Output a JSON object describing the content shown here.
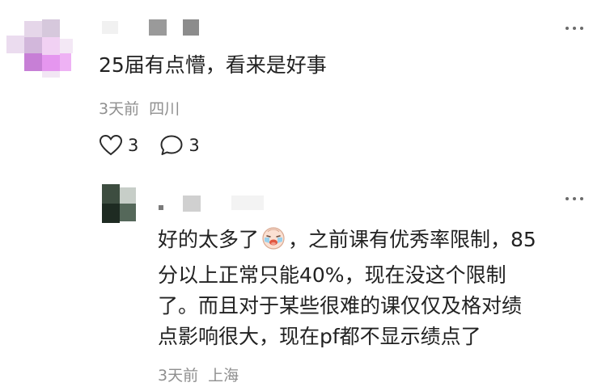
{
  "comment": {
    "text": "25届有点懵，看来是好事",
    "time": "3天前",
    "location": "四川",
    "likes": "3",
    "replies": "3"
  },
  "reply": {
    "lines": [
      {
        "before": "好的太多了",
        "emoji": "crying-laughing-face",
        "after": "，之前课有优秀率限制，85"
      },
      {
        "text": "分以上正常只能40%，现在没这个限制"
      },
      {
        "text": "了。而且对于某些很难的课仅仅及格对绩"
      },
      {
        "text": "点影响很大，现在pf都不显示绩点了"
      }
    ],
    "time": "3天前",
    "location": "上海"
  },
  "icons": {
    "like": "heart-outline-icon",
    "comment": "comment-bubble-icon",
    "more": "more-dots-icon"
  }
}
